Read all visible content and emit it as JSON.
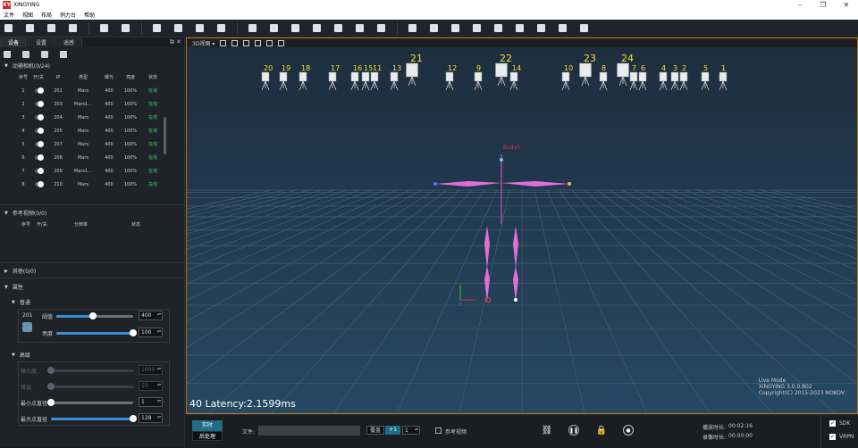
{
  "app": {
    "title": "XINGYING",
    "logo": "XY"
  },
  "menu": [
    "文件",
    "视图",
    "布局",
    "例力台",
    "帮助"
  ],
  "toolbar_icons": [
    "new-file-icon",
    "open-file-icon",
    "save-icon",
    "save-as-icon",
    "eye-off-icon",
    "export-icon",
    "close-box-icon",
    "calibrate-icon",
    "layers-icon",
    "camera-icon",
    "monitor-icon",
    "layout-1-icon",
    "layout-2-icon",
    "layout-3-icon",
    "layout-4-icon",
    "layout-5-icon",
    "layout-6-icon",
    "link-icon",
    "video-icon",
    "sphere-icon",
    "gauge-icon",
    "skeleton-icon",
    "chart-icon",
    "pin-icon",
    "image-icon",
    "list-icon"
  ],
  "left": {
    "tabs": [
      "设备",
      "设置",
      "遥感"
    ],
    "capture_section": "动捕相机(0/24)",
    "capture_headers": [
      "序号",
      "开/关",
      "IP",
      "类型",
      "曝光",
      "亮度",
      "状态"
    ],
    "cameras": [
      {
        "n": "1",
        "ip": "201",
        "type": "Mars",
        "exp": "400",
        "bright": "100%",
        "status": "在线"
      },
      {
        "n": "2",
        "ip": "203",
        "type": "Mars1...",
        "exp": "400",
        "bright": "100%",
        "status": "在线"
      },
      {
        "n": "3",
        "ip": "204",
        "type": "Mars",
        "exp": "400",
        "bright": "100%",
        "status": "在线"
      },
      {
        "n": "4",
        "ip": "205",
        "type": "Mars",
        "exp": "400",
        "bright": "100%",
        "status": "在线"
      },
      {
        "n": "5",
        "ip": "207",
        "type": "Mars",
        "exp": "400",
        "bright": "100%",
        "status": "在线"
      },
      {
        "n": "6",
        "ip": "208",
        "type": "Mars",
        "exp": "400",
        "bright": "100%",
        "status": "在线"
      },
      {
        "n": "7",
        "ip": "209",
        "type": "Mars1...",
        "exp": "400",
        "bright": "100%",
        "status": "在线"
      },
      {
        "n": "8",
        "ip": "210",
        "type": "Mars",
        "exp": "400",
        "bright": "100%",
        "status": "在线"
      }
    ],
    "ref_section": "参考视频(0/0)",
    "ref_headers": [
      "序号",
      "开/关",
      "分辨率",
      "状态"
    ],
    "other_section": "其他(0/0)",
    "props_section": "属性",
    "general_section": "普通",
    "camera_id": "201",
    "threshold_label": "阈值",
    "threshold_value": "400",
    "threshold_level": 0.48,
    "brightness_label": "亮度",
    "brightness_value": "100",
    "brightness_level": 1.0,
    "advanced_section": "高级",
    "adv_rows": [
      {
        "label": "曝光度",
        "value": "1000",
        "level": 0.0,
        "disabled": true
      },
      {
        "label": "增益",
        "value": "50",
        "level": 0.0,
        "disabled": true
      },
      {
        "label": "最小点直径",
        "value": "1",
        "level": 0.0,
        "disabled": false
      },
      {
        "label": "最大点直径",
        "value": "128",
        "level": 1.0,
        "disabled": false
      }
    ]
  },
  "viewport": {
    "view_mode": "3D视图 ▾",
    "latency": "40 Latency:2.1599ms",
    "body_label": "Body0",
    "info": [
      "Live Mode",
      "XINGYING 3.0.0.802",
      "Copyright(C) 2015-2023 NOKOV"
    ],
    "camera_labels": [
      "20",
      "19",
      "18",
      "17",
      "16",
      "15",
      "11",
      "13",
      "21",
      "12",
      "9",
      "22",
      "14",
      "10",
      "23",
      "8",
      "24",
      "7",
      "4",
      "3",
      "2",
      "5",
      "1",
      "6"
    ]
  },
  "bottom": {
    "realtime": "实时",
    "post": "后处理",
    "file_label": "文件:",
    "mode_btn": "覆盖",
    "plus_btn": "+1",
    "count": "1",
    "ref_video": "参考视频",
    "play_time_label": "播放时长:",
    "play_time": "00:02:16",
    "rec_time_label": "录像时长:",
    "rec_time": "00:00:00",
    "sdk": "SDK",
    "vrpn": "VRPN"
  }
}
